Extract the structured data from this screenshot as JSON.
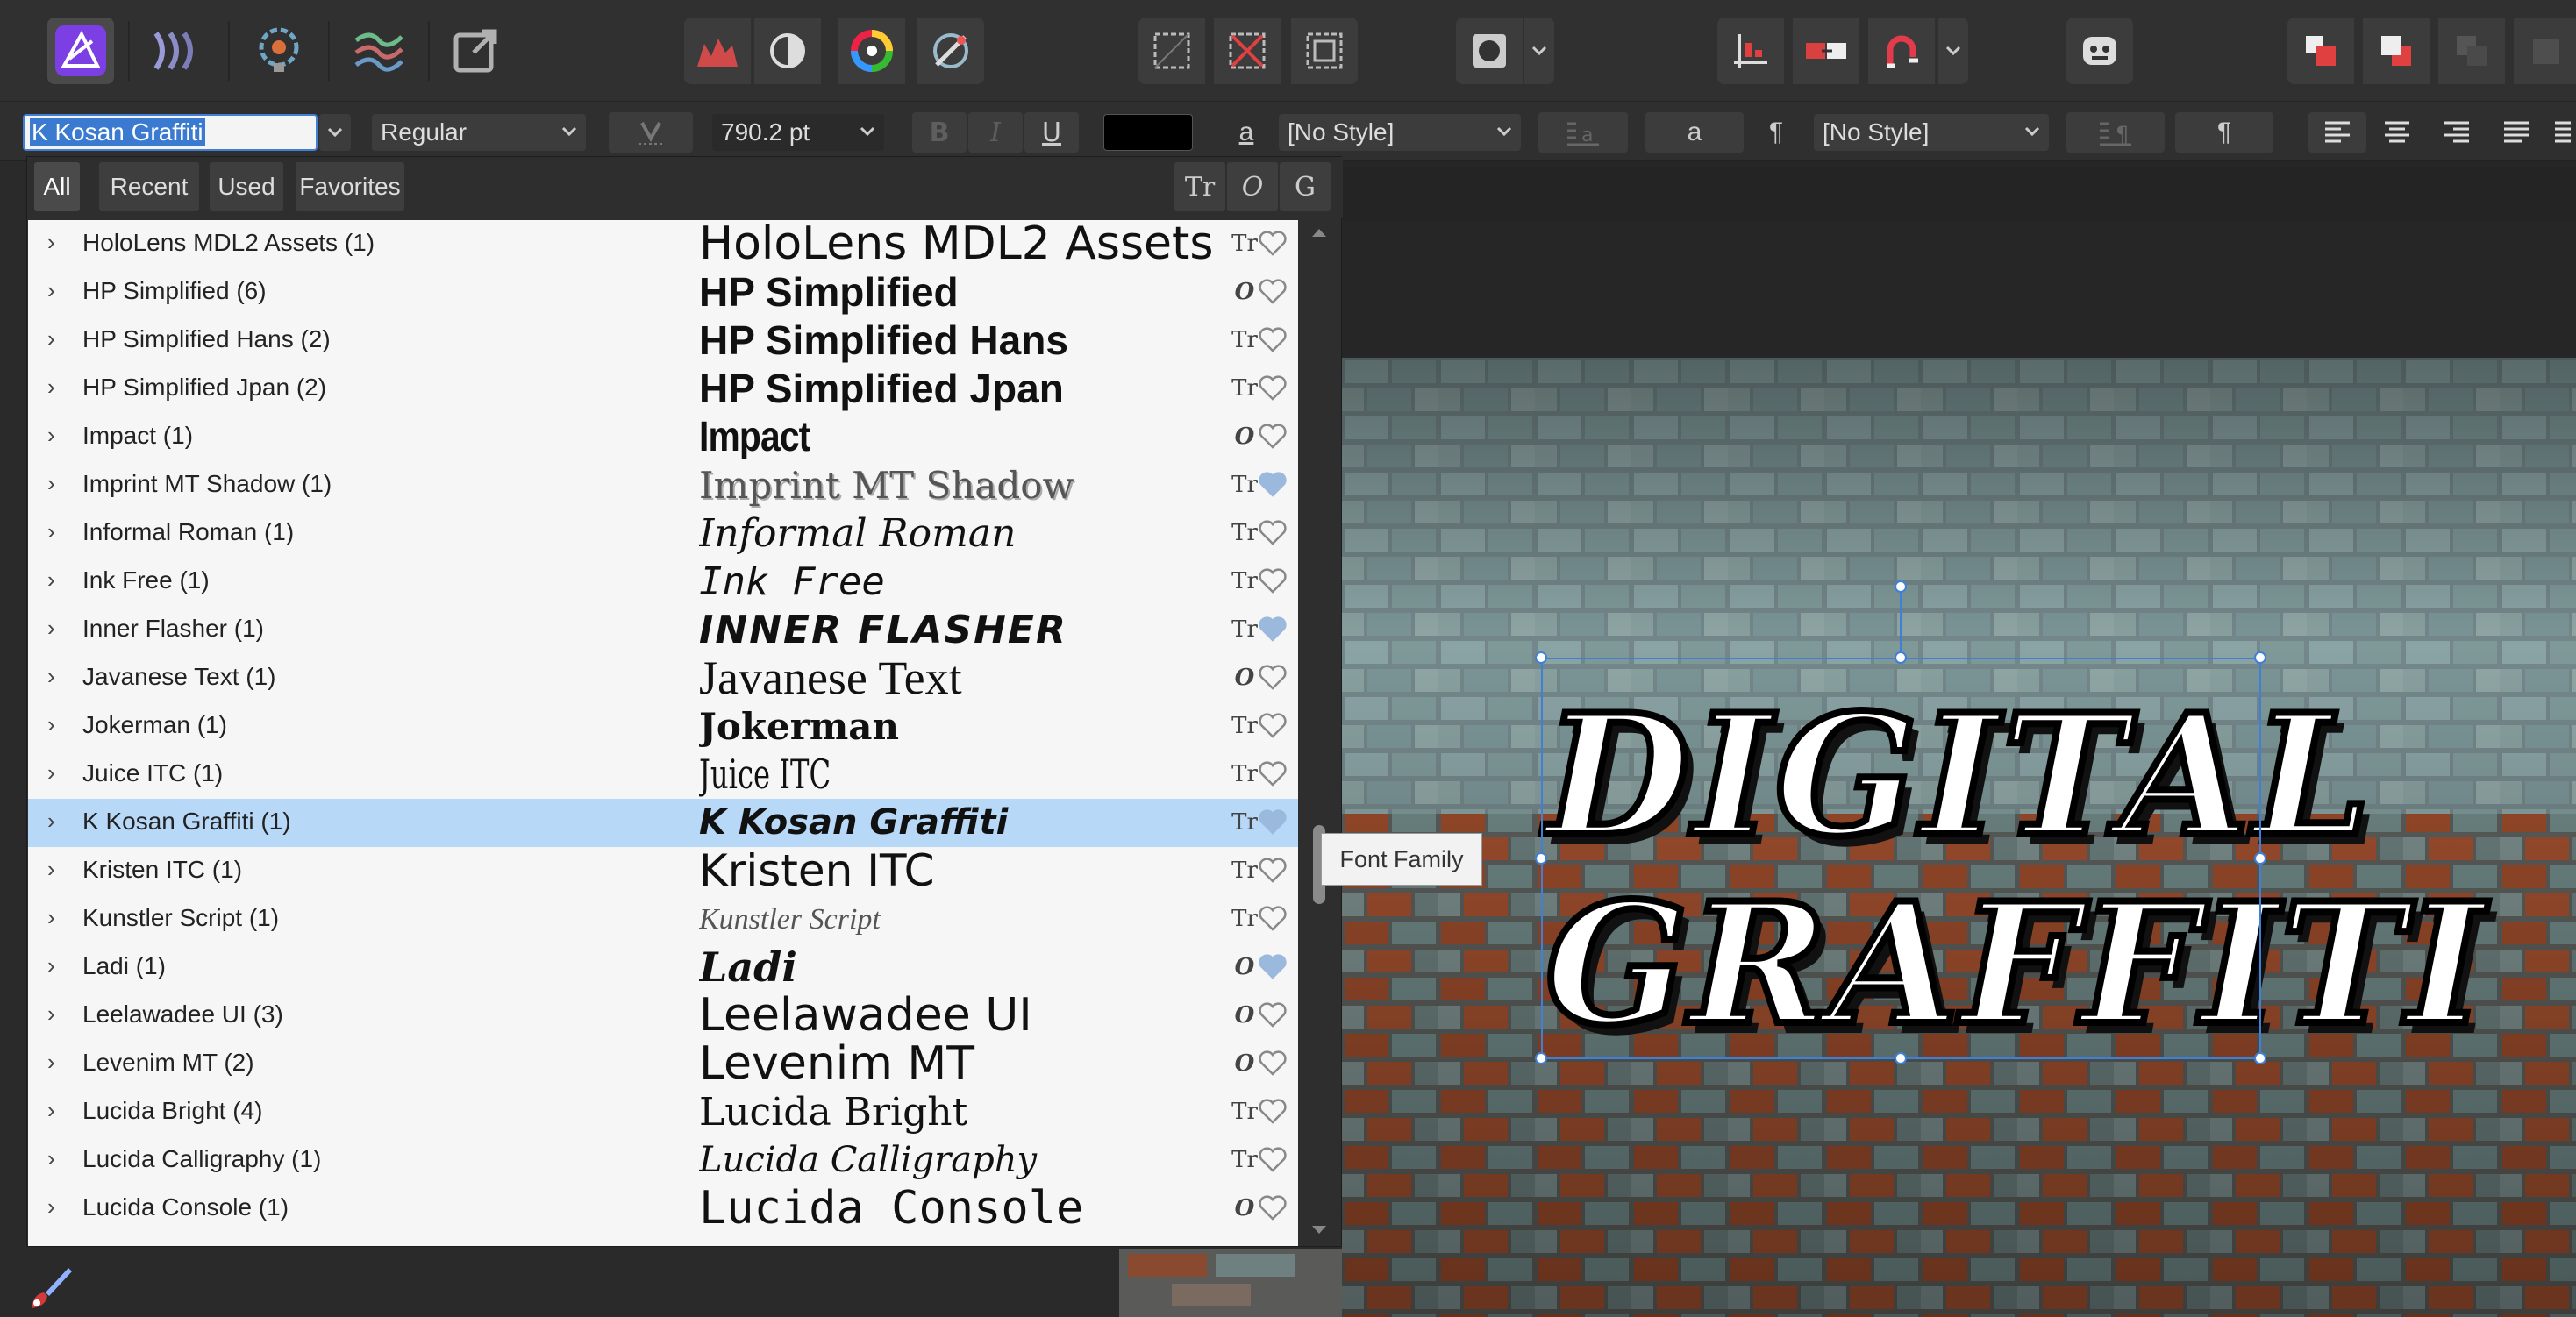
{
  "toolbar": {
    "personas": [
      "photo-persona-icon",
      "liquify-persona-icon",
      "develop-persona-icon",
      "tone-mapping-persona-icon",
      "export-persona-icon"
    ],
    "right_icon": "assistant-icon"
  },
  "context": {
    "font_family_value": "K Kosan Graffiti",
    "font_style_value": "Regular",
    "font_size_value": "790.2 pt",
    "text_color": "#000000",
    "char_style_value": "[No Style]",
    "para_style_value": "[No Style]",
    "char_style_glyph": "a",
    "para_glyph": "¶"
  },
  "panel": {
    "tabs": [
      "All",
      "Recent",
      "Used",
      "Favorites"
    ],
    "active_tab": "All",
    "filters": [
      "Tr",
      "O",
      "G"
    ]
  },
  "fonts": [
    {
      "name": "HoloLens MDL2 Assets (1)",
      "preview": "HoloLens MDL2 Assets",
      "type": "Tr",
      "fav": false
    },
    {
      "name": "HP Simplified (6)",
      "preview": "HP Simplified",
      "type": "O",
      "fav": false
    },
    {
      "name": "HP Simplified Hans (2)",
      "preview": "HP Simplified Hans",
      "type": "Tr",
      "fav": false
    },
    {
      "name": "HP Simplified Jpan (2)",
      "preview": "HP Simplified Jpan",
      "type": "Tr",
      "fav": false
    },
    {
      "name": "Impact (1)",
      "preview": "Impact",
      "type": "O",
      "fav": false
    },
    {
      "name": "Imprint MT Shadow (1)",
      "preview": "Imprint MT Shadow",
      "type": "Tr",
      "fav": true
    },
    {
      "name": "Informal Roman (1)",
      "preview": "Informal Roman",
      "type": "Tr",
      "fav": false
    },
    {
      "name": "Ink Free (1)",
      "preview": "Ink Free",
      "type": "Tr",
      "fav": false
    },
    {
      "name": "Inner Flasher (1)",
      "preview": "INNER FLASHER",
      "type": "Tr",
      "fav": true
    },
    {
      "name": "Javanese Text (1)",
      "preview": "Javanese Text",
      "type": "O",
      "fav": false
    },
    {
      "name": "Jokerman (1)",
      "preview": "Jokerman",
      "type": "Tr",
      "fav": false
    },
    {
      "name": "Juice ITC (1)",
      "preview": "Juice ITC",
      "type": "Tr",
      "fav": false
    },
    {
      "name": "K Kosan Graffiti (1)",
      "preview": "K Kosan Graffiti",
      "type": "Tr",
      "fav": true,
      "selected": true
    },
    {
      "name": "Kristen ITC (1)",
      "preview": "Kristen ITC",
      "type": "Tr",
      "fav": false
    },
    {
      "name": "Kunstler Script (1)",
      "preview": "Kunstler Script",
      "type": "Tr",
      "fav": false
    },
    {
      "name": "Ladi (1)",
      "preview": "Ladi",
      "type": "O",
      "fav": true
    },
    {
      "name": "Leelawadee UI (3)",
      "preview": "Leelawadee UI",
      "type": "O",
      "fav": false
    },
    {
      "name": "Levenim MT (2)",
      "preview": "Levenim MT",
      "type": "O",
      "fav": false
    },
    {
      "name": "Lucida Bright (4)",
      "preview": "Lucida Bright",
      "type": "Tr",
      "fav": false
    },
    {
      "name": "Lucida Calligraphy (1)",
      "preview": "Lucida Calligraphy",
      "type": "Tr",
      "fav": false
    },
    {
      "name": "Lucida Console (1)",
      "preview": "Lucida Console",
      "type": "O",
      "fav": false
    }
  ],
  "tooltip": "Font Family",
  "canvas": {
    "graffiti_line1": "DIGITAL",
    "graffiti_line2": "GRAFFITI"
  },
  "colors": {
    "accent": "#3f7fd6",
    "selection_row": "#b8d8f8",
    "fav_filled": "#9bb8dd",
    "brick_mortar": "#7f918f",
    "brick_red": "#9a4a2c"
  }
}
